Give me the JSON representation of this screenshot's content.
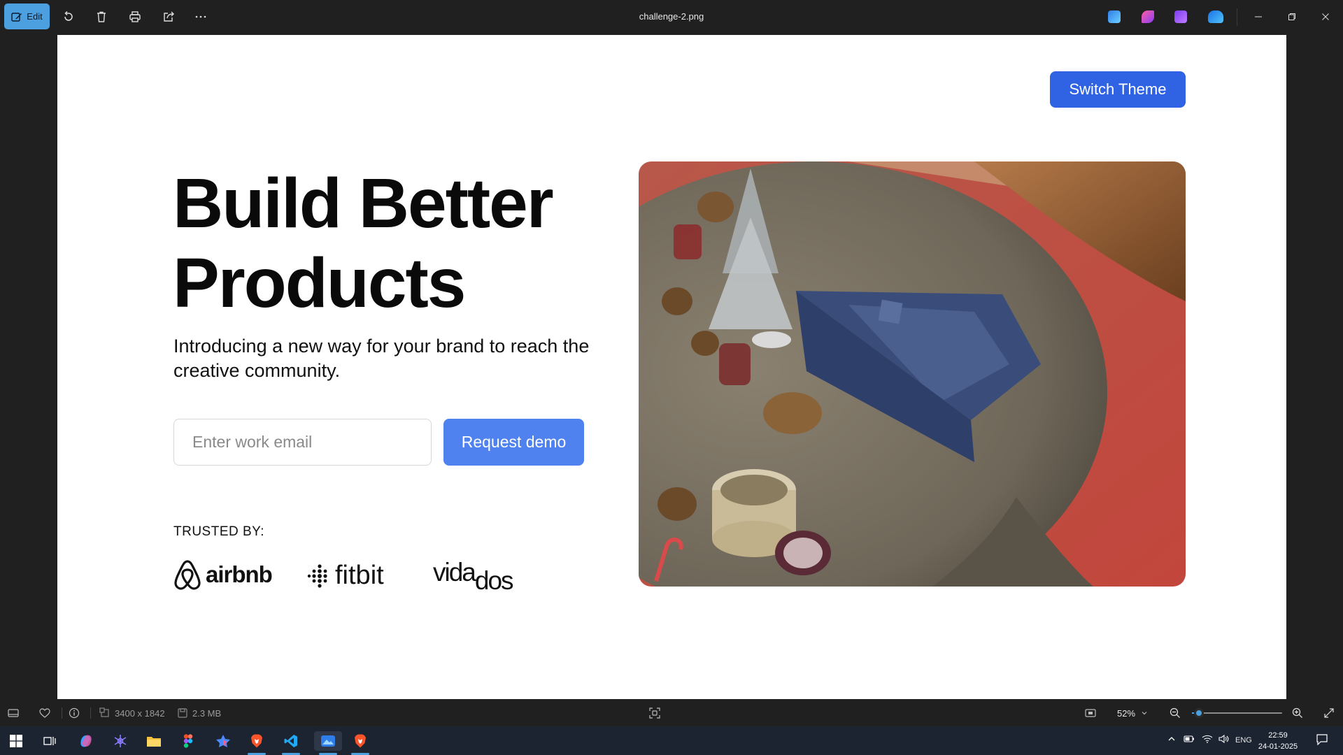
{
  "titlebar": {
    "edit_label": "Edit",
    "file_name": "challenge-2.png",
    "tools": [
      "rotate-icon",
      "delete-icon",
      "print-icon",
      "share-icon",
      "more-icon"
    ],
    "app_icons": [
      "photos-editor-icon",
      "clipchamp-icon",
      "video-editor-icon",
      "onedrive-icon"
    ]
  },
  "page": {
    "switch_theme": "Switch Theme",
    "headline_line1": "Build Better",
    "headline_line2": "Products",
    "subtitle": "Introducing a new way for your brand to reach the creative community.",
    "email_placeholder": "Enter work email",
    "demo_button": "Request demo",
    "trusted_by": "TRUSTED BY:",
    "logos": {
      "airbnb": "airbnb",
      "fitbit": "fitbit",
      "vidados_main": "vida",
      "vidados_sub": "dos"
    },
    "colors": {
      "switch_theme_bg": "#2f63e4",
      "demo_button_bg": "#4f82ee"
    }
  },
  "statusbar": {
    "dimensions": "3400 x 1842",
    "file_size": "2.3 MB",
    "zoom": "52%",
    "zoom_fraction": 0.08
  },
  "taskbar": {
    "language": "ENG",
    "time": "22:59",
    "date": "24-01-2025"
  }
}
